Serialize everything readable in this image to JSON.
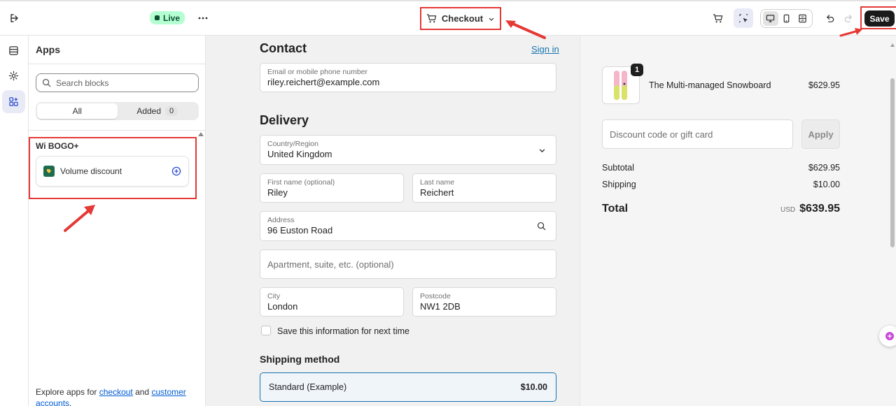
{
  "topbar": {
    "live_label": "Live",
    "page_selector": "Checkout",
    "save_label": "Save"
  },
  "apps_panel": {
    "title": "Apps",
    "search_placeholder": "Search blocks",
    "tabs": [
      {
        "label": "All",
        "active": true
      },
      {
        "label": "Added",
        "count": "0"
      }
    ],
    "group_label": "Wi BOGO+",
    "app_item": "Volume discount",
    "footer_prefix": "Explore apps for ",
    "footer_link1": "checkout",
    "footer_mid": " and ",
    "footer_link2": "customer accounts",
    "footer_suffix": "."
  },
  "checkout": {
    "contact_title": "Contact",
    "sign_in": "Sign in",
    "email_label": "Email or mobile phone number",
    "email_value": "riley.reichert@example.com",
    "delivery_title": "Delivery",
    "country_label": "Country/Region",
    "country_value": "United Kingdom",
    "first_name_label": "First name (optional)",
    "first_name_value": "Riley",
    "last_name_label": "Last name",
    "last_name_value": "Reichert",
    "address_label": "Address",
    "address_value": "96 Euston Road",
    "apartment_placeholder": "Apartment, suite, etc. (optional)",
    "city_label": "City",
    "city_value": "London",
    "postcode_label": "Postcode",
    "postcode_value": "NW1 2DB",
    "save_info": "Save this information for next time",
    "shipping_title": "Shipping method",
    "shipping_option": "Standard (Example)",
    "shipping_price": "$10.00"
  },
  "summary": {
    "qty": "1",
    "product_name": "The Multi-managed Snowboard",
    "product_price": "$629.95",
    "discount_placeholder": "Discount code or gift card",
    "apply_label": "Apply",
    "subtotal_label": "Subtotal",
    "subtotal_value": "$629.95",
    "shipping_label": "Shipping",
    "shipping_value": "$10.00",
    "total_label": "Total",
    "currency": "USD",
    "total_value": "$639.95"
  },
  "colors": {
    "annotation_red": "#e53935",
    "link_blue": "#1773b0",
    "live_green": "#b4fed2"
  }
}
